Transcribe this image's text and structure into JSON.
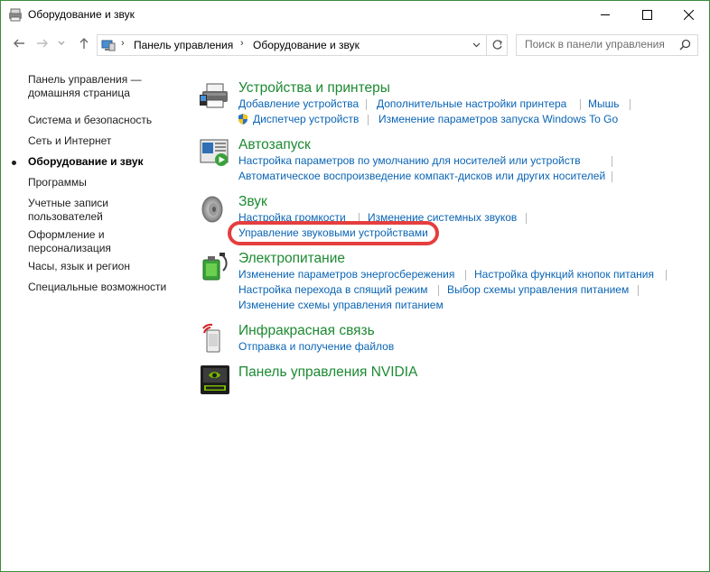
{
  "window": {
    "title": "Оборудование и звук"
  },
  "nav": {
    "breadcrumb": [
      "Панель управления",
      "Оборудование и звук"
    ],
    "search_placeholder": "Поиск в панели управления"
  },
  "sidebar": {
    "items": [
      {
        "label": "Панель управления — домашняя страница",
        "current": false
      },
      {
        "label": "Система и безопасность",
        "current": false
      },
      {
        "label": "Сеть и Интернет",
        "current": false
      },
      {
        "label": "Оборудование и звук",
        "current": true
      },
      {
        "label": "Программы",
        "current": false
      },
      {
        "label": "Учетные записи пользователей",
        "current": false
      },
      {
        "label": "Оформление и персонализация",
        "current": false
      },
      {
        "label": "Часы, язык и регион",
        "current": false
      },
      {
        "label": "Специальные возможности",
        "current": false
      }
    ]
  },
  "categories": [
    {
      "title": "Устройства и принтеры",
      "icon": "printer-icon",
      "links": [
        "Добавление устройства",
        "Дополнительные настройки принтера",
        "Мышь",
        "Диспетчер устройств",
        "Изменение параметров запуска Windows To Go"
      ]
    },
    {
      "title": "Автозапуск",
      "icon": "autoplay-icon",
      "links": [
        "Настройка параметров по умолчанию для носителей или устройств",
        "Автоматическое воспроизведение компакт-дисков или других носителей"
      ]
    },
    {
      "title": "Звук",
      "icon": "speaker-icon",
      "links": [
        "Настройка громкости",
        "Изменение системных звуков",
        "Управление звуковыми устройствами"
      ]
    },
    {
      "title": "Электропитание",
      "icon": "power-icon",
      "links": [
        "Изменение параметров энергосбережения",
        "Настройка функций кнопок питания",
        "Настройка перехода в спящий режим",
        "Выбор схемы управления питанием",
        "Изменение схемы управления питанием"
      ]
    },
    {
      "title": "Инфракрасная связь",
      "icon": "infrared-icon",
      "links": [
        "Отправка и получение файлов"
      ]
    },
    {
      "title": "Панель управления NVIDIA",
      "icon": "nvidia-icon",
      "links": []
    }
  ],
  "colors": {
    "accent_green": "#1c8a32",
    "link_blue": "#0a64b4",
    "highlight_red": "#e53e3e"
  }
}
